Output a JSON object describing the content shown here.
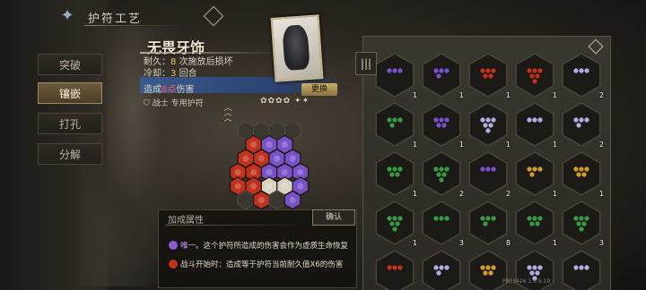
{
  "header": {
    "title": "护符工艺",
    "rune_icon": "rune-emblem-icon"
  },
  "sidebar": {
    "tabs": [
      {
        "label": "突破",
        "active": false
      },
      {
        "label": "镶嵌",
        "active": true
      },
      {
        "label": "打孔",
        "active": false
      },
      {
        "label": "分解",
        "active": false
      }
    ]
  },
  "item": {
    "name": "无畏牙饰",
    "durability_label": "耐久：",
    "durability_value": "8",
    "durability_suffix": "次施放后损坏",
    "cooldown_label": "冷却：",
    "cooldown_value": "3",
    "cooldown_suffix": "回合",
    "damage_prefix": "造成",
    "damage_value": "8点",
    "damage_suffix": "伤害",
    "owner_label": "战士 专用护符",
    "swap_label": "更换",
    "pips": "✿✿✿✿ ✦✦"
  },
  "board": {
    "rows": [
      [
        "empty",
        "empty",
        "empty",
        "empty"
      ],
      [
        "red",
        "purple",
        "purple"
      ],
      [
        "red",
        "red",
        "purple",
        "purple"
      ],
      [
        "red",
        "red",
        "purple",
        "purple",
        "purple"
      ],
      [
        "red",
        "red",
        "white",
        "white",
        "purple"
      ],
      [
        "empty",
        "red",
        "empty",
        "purple"
      ]
    ],
    "colors": {
      "red": "#c0321e",
      "purple": "#7a52c8",
      "white": "#d8d2c0",
      "empty": "#3a3630",
      "gold": "#d09a2a",
      "green": "#3a9a42"
    }
  },
  "bonus": {
    "title": "加成属性",
    "confirm_label": "确认",
    "effects": [
      {
        "prefix": "唯一",
        "text": "。这个护符所造成的伤害会作为虚质生命恢复",
        "icon_color": "#8a5ad0"
      },
      {
        "prefix": "战斗开始时",
        "text": "：造成等于护符当前耐久值X6的伤害",
        "icon_color": "#c0321e"
      }
    ]
  },
  "inventory": {
    "slots": [
      {
        "color": "purple",
        "count": "1"
      },
      {
        "color": "purple",
        "count": "1"
      },
      {
        "color": "red",
        "count": "1"
      },
      {
        "color": "red",
        "count": "1"
      },
      {
        "color": "lilac",
        "count": "2"
      },
      {
        "color": "green",
        "count": "1"
      },
      {
        "color": "purple",
        "count": "1"
      },
      {
        "color": "lilac",
        "count": "1"
      },
      {
        "color": "lilac",
        "count": "1"
      },
      {
        "color": "lilac",
        "count": "2"
      },
      {
        "color": "green",
        "count": "1"
      },
      {
        "color": "green",
        "count": "2"
      },
      {
        "color": "purple",
        "count": "2"
      },
      {
        "color": "gold",
        "count": "1"
      },
      {
        "color": "gold",
        "count": "1"
      },
      {
        "color": "green",
        "count": "1"
      },
      {
        "color": "green",
        "count": "3"
      },
      {
        "color": "green",
        "count": "8"
      },
      {
        "color": "green",
        "count": "1"
      },
      {
        "color": "green",
        "count": "3"
      },
      {
        "color": "red",
        "count": ""
      },
      {
        "color": "lilac",
        "count": ""
      },
      {
        "color": "gold",
        "count": ""
      },
      {
        "color": "lilac",
        "count": ""
      },
      {
        "color": "lilac",
        "count": ""
      }
    ],
    "version": "P803426 1.0.5.19"
  }
}
